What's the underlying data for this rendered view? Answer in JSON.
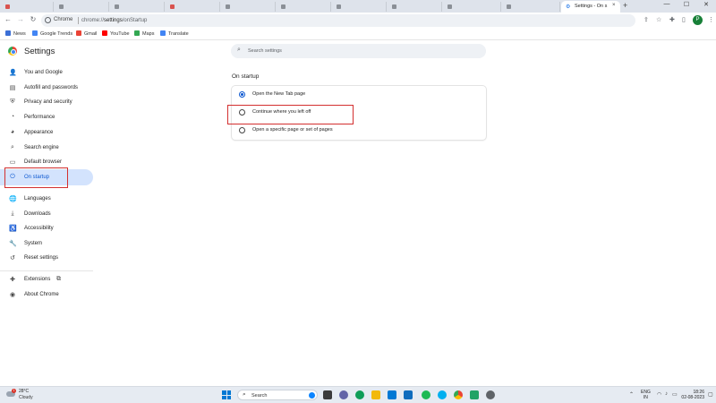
{
  "browser": {
    "active_tab_title": "Settings - On s",
    "new_tab_symbol": "+",
    "tab_close_symbol": "×",
    "window_controls": {
      "minimize": "—",
      "maximize": "☐",
      "close": "✕"
    },
    "nav": {
      "back": "←",
      "forward": "→",
      "reload": "↻"
    },
    "omnibox_chip": "Chrome",
    "url_prefix": "chrome://",
    "url_bold": "settings",
    "url_suffix": "/onStartup",
    "profile_initial": "P"
  },
  "bookmarks": [
    {
      "label": "News",
      "icon": "news-icon",
      "color": "#3b6fd6"
    },
    {
      "label": "Google Trends",
      "icon": "trends-icon",
      "color": "#4285f4"
    },
    {
      "label": "Gmail",
      "icon": "gmail-icon",
      "color": "#ea4335"
    },
    {
      "label": "YouTube",
      "icon": "youtube-icon",
      "color": "#ff0000"
    },
    {
      "label": "Maps",
      "icon": "maps-icon",
      "color": "#34a853"
    },
    {
      "label": "Translate",
      "icon": "translate-icon",
      "color": "#4285f4"
    }
  ],
  "settings": {
    "title": "Settings",
    "search_placeholder": "Search settings"
  },
  "sidebar": {
    "items": [
      {
        "label": "You and Google",
        "icon": "person-icon"
      },
      {
        "label": "Autofill and passwords",
        "icon": "clipboard-icon"
      },
      {
        "label": "Privacy and security",
        "icon": "shield-icon"
      },
      {
        "label": "Performance",
        "icon": "gauge-icon"
      },
      {
        "label": "Appearance",
        "icon": "palette-icon"
      },
      {
        "label": "Search engine",
        "icon": "search-icon"
      },
      {
        "label": "Default browser",
        "icon": "browser-icon"
      },
      {
        "label": "On startup",
        "icon": "power-icon",
        "selected": true
      },
      {
        "label": "Languages",
        "icon": "globe-icon"
      },
      {
        "label": "Downloads",
        "icon": "download-icon"
      },
      {
        "label": "Accessibility",
        "icon": "accessibility-icon"
      },
      {
        "label": "System",
        "icon": "wrench-icon"
      },
      {
        "label": "Reset settings",
        "icon": "reset-icon"
      },
      {
        "label": "Extensions",
        "icon": "puzzle-icon"
      },
      {
        "label": "About Chrome",
        "icon": "chrome-icon"
      }
    ]
  },
  "content": {
    "section_title": "On startup",
    "options": [
      {
        "label": "Open the New Tab page",
        "checked": true
      },
      {
        "label": "Continue where you left off",
        "checked": false
      },
      {
        "label": "Open a specific page or set of pages",
        "checked": false
      }
    ]
  },
  "highlight_color": "#d32f2f",
  "taskbar": {
    "weather_temp": "28°C",
    "weather_desc": "Cloudy",
    "weather_badge": "1",
    "search_label": "Search",
    "lang_line1": "ENG",
    "lang_line2": "IN",
    "time": "18:26",
    "date": "02-08-2023"
  }
}
